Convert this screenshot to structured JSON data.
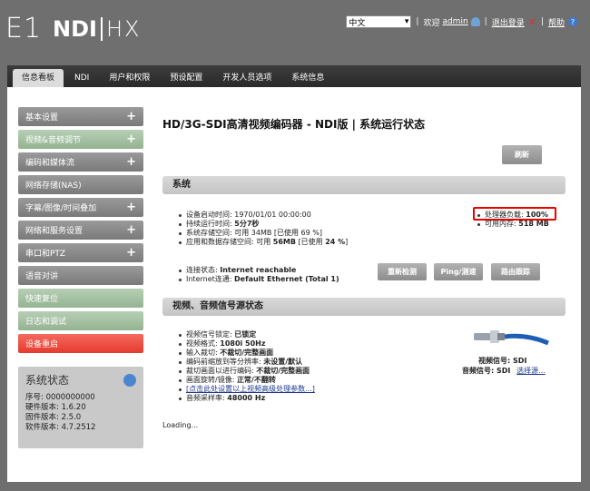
{
  "header": {
    "logo": {
      "e1": "E1",
      "ndi": "NDI",
      "hx": "HX"
    },
    "language": "中文",
    "welcome": "欢迎",
    "user": "admin",
    "logout": "退出登录",
    "help": "帮助"
  },
  "nav": {
    "tabs": [
      "信息看板",
      "NDI",
      "用户和权限",
      "预设配置",
      "开发人员选项",
      "系统信息"
    ]
  },
  "sidebar": {
    "items": [
      {
        "label": "基本设置",
        "style": "gray",
        "plus": "+"
      },
      {
        "label": "视频&音频调节",
        "style": "green",
        "plus": "+"
      },
      {
        "label": "编码和媒体流",
        "style": "gray",
        "plus": "+"
      },
      {
        "label": "网络存储(NAS)",
        "style": "gray",
        "plus": ""
      },
      {
        "label": "字幕/图像/时间叠加",
        "style": "gray",
        "plus": "+"
      },
      {
        "label": "网络和服务设置",
        "style": "gray",
        "plus": "+"
      },
      {
        "label": "串口和PTZ",
        "style": "gray",
        "plus": "+"
      },
      {
        "label": "语音对讲",
        "style": "gray",
        "plus": ""
      },
      {
        "label": "快速复位",
        "style": "green",
        "plus": ""
      },
      {
        "label": "日志和调试",
        "style": "green",
        "plus": ""
      },
      {
        "label": "设备重启",
        "style": "red",
        "plus": ""
      }
    ],
    "status": {
      "title": "系统状态",
      "serial": "序号: 0000000000",
      "hw": "硬件版本: 1.6.20",
      "fw": "固件版本: 2.5.0",
      "sw": "软件版本: 4.7.2512"
    }
  },
  "main": {
    "title": "HD/3G-SDI高清视频编码器 - NDI版 | 系统运行状态",
    "refresh": "刷新",
    "system": {
      "heading": "系统",
      "boot_label": "设备启动时间: ",
      "boot_value": "1970/01/01 00:00:00",
      "uptime_label": "持续运行时间: ",
      "uptime_value": "5分7秒",
      "storage_label": "系统存储空间: 可用 34MB [已使用 69 %]",
      "appstorage_label": "应用和数据存储空间: 可用 ",
      "appstorage_value": "56MB",
      "appstorage_tail": " [已使用 ",
      "appstorage_pct": "24 %",
      "appstorage_end": "]",
      "cpu_label": "处理器负载: ",
      "cpu_value": "100%",
      "mem_label": "可用内存: ",
      "mem_value": "518 MB",
      "conn_label": "连接状态: ",
      "conn_value": "Internet reachable",
      "speed_label": "Internet连通: ",
      "speed_value": "Default Ethernet (Total 1)",
      "btn_recheck": "重新检测",
      "btn_ping": "Ping/测速",
      "btn_trace": "路由跟踪"
    },
    "av": {
      "heading": "视频、音频信号源状态",
      "lock_label": "视频信号锁定: ",
      "lock_value": "已锁定",
      "format_label": "视频格式: ",
      "format_value": "1080i 50Hz",
      "input_label": "输入裁切: ",
      "input_value": "不裁切/完整画面",
      "scale_label": "编码前缩放到等分辨率: ",
      "scale_value": "未设置/默认",
      "crop_label": "裁切画面以进行编码: ",
      "crop_value": "不裁切/完整画面",
      "rotate_label": "画面旋转/镜像: ",
      "rotate_value": "正常/不翻转",
      "advanced_link": "[点击此处设置以上视频高级处理参数...]",
      "audio_label": "音频采样率: ",
      "audio_value": "48000 Hz",
      "vsig_label": "视频信号: ",
      "vsig_value": "SDI",
      "asig_label": "音频信号: ",
      "asig_value": "SDI",
      "asig_select": "选择源..."
    },
    "loading": "Loading..."
  }
}
